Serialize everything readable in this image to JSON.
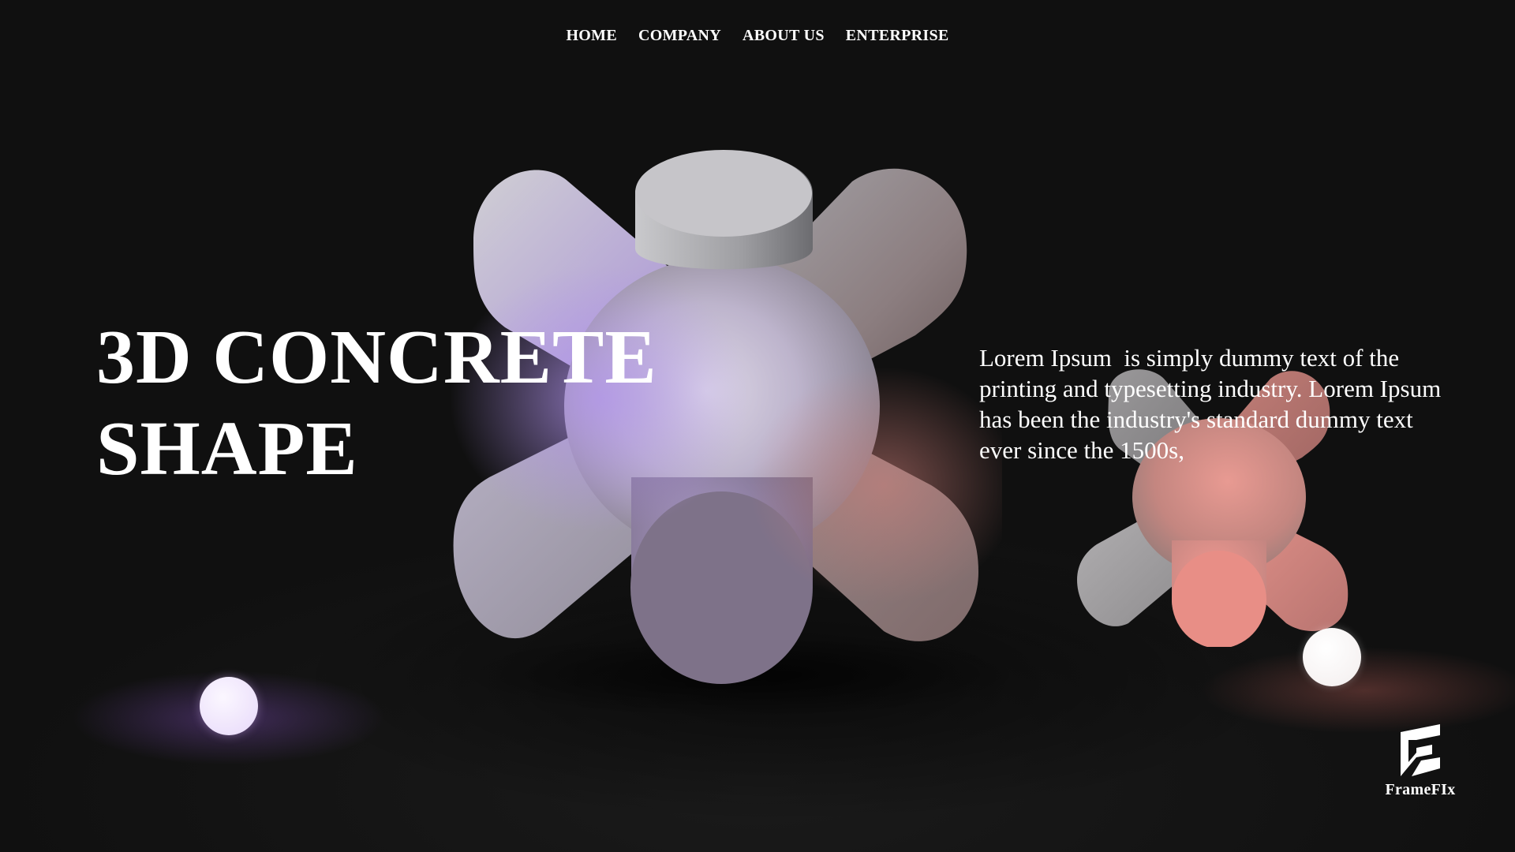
{
  "nav": {
    "items": [
      {
        "label": "HOME"
      },
      {
        "label": "COMPANY"
      },
      {
        "label": "ABOUT US"
      },
      {
        "label": "ENTERPRISE"
      }
    ]
  },
  "hero": {
    "headline_line1": "3D CONCRETE",
    "headline_line2": "SHAPE",
    "description": "Lorem Ipsum  is simply dummy text of the printing and typesetting industry. Lorem Ipsum has been the industry's standard dummy text ever since the 1500s,"
  },
  "visuals": {
    "main_shape": "3d-cross-shape",
    "small_shape": "3d-cross-shape",
    "spheres": [
      "white-sphere",
      "white-sphere"
    ],
    "colors": {
      "background": "#121212",
      "text": "#ffffff",
      "purple_tint": "#b49ae8",
      "pink_tint": "#f08c84"
    }
  },
  "brand": {
    "name": "FrameFIx",
    "logo_icon": "framefix-logo-icon"
  }
}
